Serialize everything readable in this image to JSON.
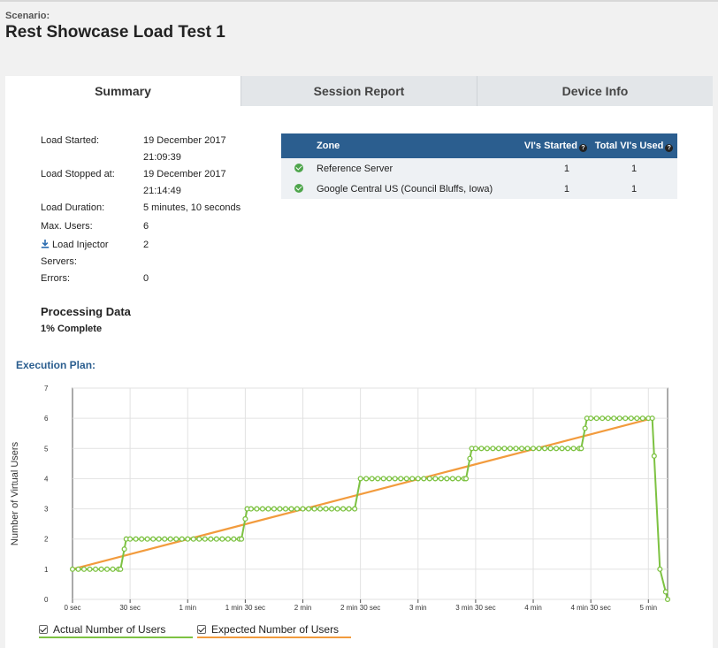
{
  "scenario_label": "Scenario:",
  "title": "Rest Showcase Load Test 1",
  "tabs": [
    {
      "label": "Summary",
      "active": true
    },
    {
      "label": "Session Report",
      "active": false
    },
    {
      "label": "Device Info",
      "active": false
    }
  ],
  "info": {
    "load_started_label": "Load Started:",
    "load_started_date": "19 December 2017",
    "load_started_time": "21:09:39",
    "load_stopped_label": "Load Stopped at:",
    "load_stopped_date": "19 December 2017",
    "load_stopped_time": "21:14:49",
    "duration_label": "Load Duration:",
    "duration_value": "5 minutes, 10 seconds",
    "max_users_label": "Max. Users:",
    "max_users_value": "6",
    "injector_label_1": "Load Injector",
    "injector_label_2": "Servers:",
    "injector_value": "2",
    "errors_label": "Errors:",
    "errors_value": "0"
  },
  "processing": {
    "title": "Processing Data",
    "status": "1% Complete"
  },
  "zones": {
    "headers": {
      "zone": "Zone",
      "started": "VI's Started",
      "total": "Total VI's Used"
    },
    "rows": [
      {
        "zone": "Reference Server",
        "started": "1",
        "total": "1"
      },
      {
        "zone": "Google Central US (Council Bluffs, Iowa)",
        "started": "1",
        "total": "1"
      }
    ]
  },
  "execution_plan_title": "Execution Plan:",
  "legend": {
    "actual": "Actual Number of Users",
    "expected": "Expected Number of Users"
  },
  "colors": {
    "actual": "#7dc242",
    "expected": "#f29b3d",
    "header": "#2b5e8f"
  },
  "chart_data": {
    "type": "line",
    "ylabel": "Number of Virtual Users",
    "xlabel": "",
    "ylim": [
      0,
      7
    ],
    "xlim": [
      0,
      310
    ],
    "x_ticks": [
      {
        "value": 0,
        "label": "0 sec"
      },
      {
        "value": 30,
        "label": "30 sec"
      },
      {
        "value": 60,
        "label": "1 min"
      },
      {
        "value": 90,
        "label": "1 min 30 sec"
      },
      {
        "value": 120,
        "label": "2 min"
      },
      {
        "value": 150,
        "label": "2 min 30 sec"
      },
      {
        "value": 180,
        "label": "3 min"
      },
      {
        "value": 210,
        "label": "3 min 30 sec"
      },
      {
        "value": 240,
        "label": "4 min"
      },
      {
        "value": 270,
        "label": "4 min 30 sec"
      },
      {
        "value": 300,
        "label": "5 min"
      }
    ],
    "y_ticks": [
      0,
      1,
      2,
      3,
      4,
      5,
      6,
      7
    ],
    "grid": true,
    "series": [
      {
        "name": "Actual Number of Users",
        "points": [
          [
            0,
            1
          ],
          [
            25,
            1
          ],
          [
            28,
            2
          ],
          [
            88,
            2
          ],
          [
            91,
            3
          ],
          [
            147,
            3
          ],
          [
            150,
            4
          ],
          [
            205,
            4
          ],
          [
            208,
            5
          ],
          [
            265,
            5
          ],
          [
            268,
            6
          ],
          [
            302,
            6
          ],
          [
            306,
            1
          ],
          [
            310,
            0
          ]
        ]
      },
      {
        "name": "Expected Number of Users",
        "points": [
          [
            0,
            1
          ],
          [
            302,
            6
          ]
        ]
      }
    ]
  }
}
